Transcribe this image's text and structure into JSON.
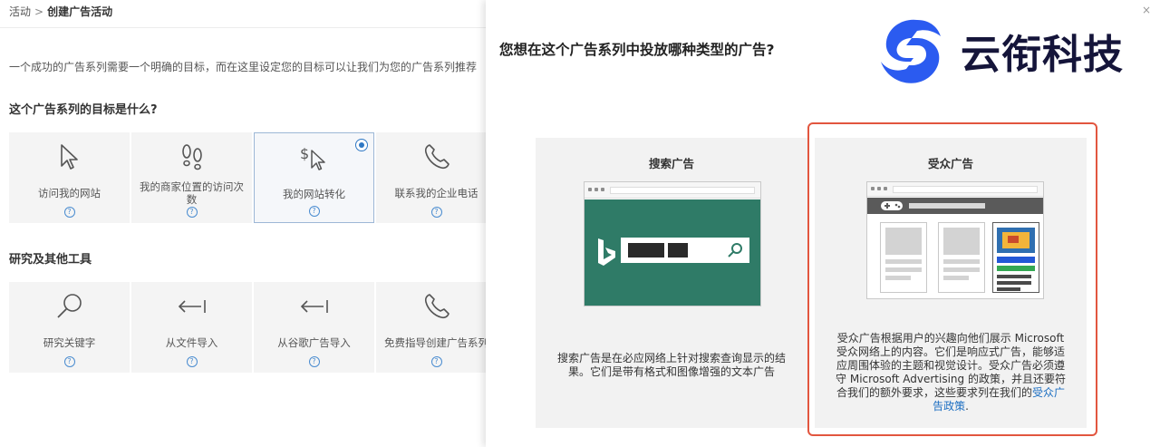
{
  "breadcrumb": {
    "root": "活动",
    "separator": ">",
    "current": "创建广告活动"
  },
  "left": {
    "intro": "一个成功的广告系列需要一个明确的目标，而在这里设定您的目标可以让我们为您的广告系列推荐",
    "goal_title": "这个广告系列的目标是什么?",
    "goals": [
      {
        "label": "访问我的网站",
        "icon": "cursor-icon"
      },
      {
        "label": "我的商家位置的访问次数",
        "icon": "footprints-icon"
      },
      {
        "label": "我的网站转化",
        "icon": "dollar-cursor-icon",
        "selected": true
      },
      {
        "label": "联系我的企业电话",
        "icon": "phone-icon"
      }
    ],
    "tools_title": "研究及其他工具",
    "tools": [
      {
        "label": "研究关键字",
        "icon": "magnifier-icon"
      },
      {
        "label": "从文件导入",
        "icon": "arrow-left-bar-icon"
      },
      {
        "label": "从谷歌广告导入",
        "icon": "arrow-left-bar-icon"
      },
      {
        "label": "免费指导创建广告系列",
        "icon": "phone-icon"
      }
    ],
    "help_glyph": "?"
  },
  "modal": {
    "title": "您想在这个广告系列中投放哪种类型的广告?",
    "close_glyph": "×",
    "logo_text": "云衔科技",
    "search_card": {
      "title": "搜索广告",
      "description": "搜索广告是在必应网络上针对搜索查询显示的结果。它们是带有格式和图像增强的文本广告"
    },
    "audience_card": {
      "title": "受众广告",
      "description": "受众广告根据用户的兴趣向他们展示 Microsoft 受众网络上的内容。它们是响应式广告，能够适应周围体验的主题和视觉设计。受众广告必须遵守 Microsoft Advertising 的政策，并且还要符合我们的额外要求，这些要求列在我们的",
      "link_text": "受众广告政策",
      "trailing": "."
    }
  },
  "colors": {
    "accent_blue": "#2f78c4",
    "bing_green": "#2f7b67",
    "highlight_red": "#e2563f",
    "link_blue": "#1d6fc2",
    "logo_blue": "#2b5bf0"
  }
}
